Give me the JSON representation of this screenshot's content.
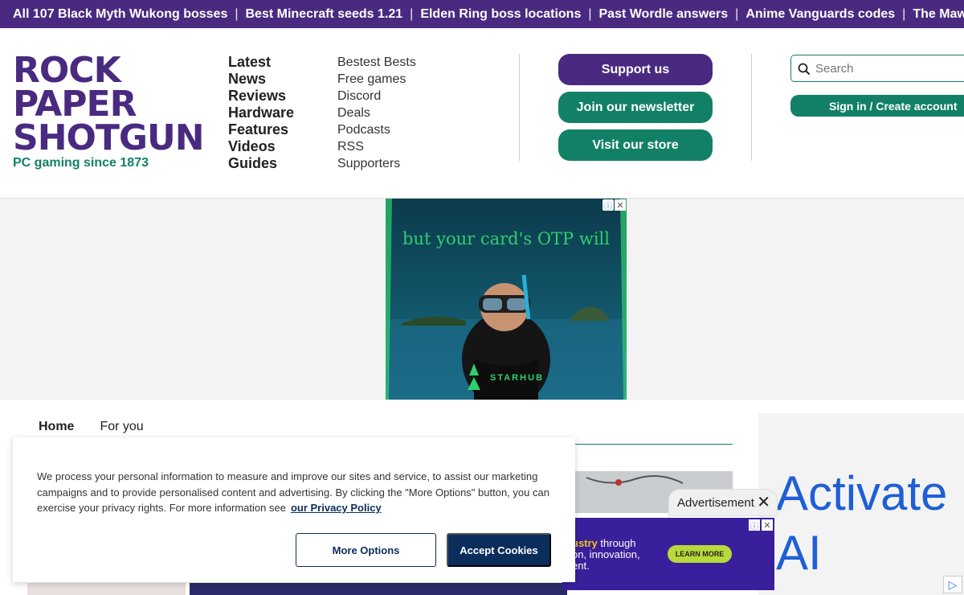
{
  "trending": {
    "links": [
      "All 107 Black Myth Wukong bosses",
      "Best Minecraft seeds 1.21",
      "Elden Ring boss locations",
      "Past Wordle answers",
      "Anime Vanguards codes",
      "The Maw"
    ],
    "separator": "|"
  },
  "logo": {
    "lines": [
      "ROCK",
      "PAPER",
      "SHOTGUN"
    ],
    "tagline": "PC gaming since 1873"
  },
  "nav": {
    "primary": [
      "Latest",
      "News",
      "Reviews",
      "Hardware",
      "Features",
      "Videos",
      "Guides"
    ],
    "secondary": [
      "Bestest Bests",
      "Free games",
      "Discord",
      "Deals",
      "Podcasts",
      "RSS",
      "Supporters"
    ]
  },
  "actions": {
    "support": "Support us",
    "newsletter": "Join our newsletter",
    "store": "Visit our store"
  },
  "search": {
    "placeholder": "Search"
  },
  "account": {
    "signin": "Sign in / Create account"
  },
  "top_ad": {
    "headline": "but your card's OTP will",
    "brand": "STARHUB",
    "info": "ⓘ",
    "close": "✕"
  },
  "tabs": {
    "home": "Home",
    "for_you": "For you"
  },
  "advertisement": {
    "label": "Advertisement",
    "close": "✕",
    "line1_highlight": "ustry",
    "line1_rest": " through",
    "line2": "on, innovation,",
    "line3": "ent.",
    "cta": "LEARN MORE"
  },
  "side_ad": {
    "lines": [
      "Activate",
      "AI"
    ]
  },
  "cookie": {
    "text": "We process your personal information to measure and improve our sites and service, to assist our marketing campaigns and to provide personalised content and advertising. By clicking the \"More Options\" button, you can exercise your privacy rights. For more information see",
    "link": "our Privacy Policy",
    "more_options": "More Options",
    "accept": "Accept Cookies"
  },
  "colors": {
    "brand_purple": "#4a2a80",
    "brand_green": "#128066",
    "cookie_navy": "#0b2d5c"
  }
}
